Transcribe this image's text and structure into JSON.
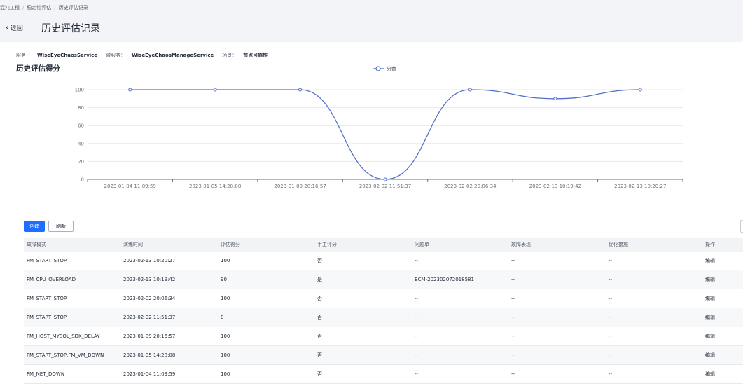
{
  "breadcrumb": [
    "混沌工程",
    "稳定性评估",
    "历史评估记录"
  ],
  "header": {
    "back_label": "返回",
    "title": "历史评估记录"
  },
  "meta": {
    "service_label": "服务：",
    "service_value": "WiseEyeChaosService",
    "micro_label": "微服务：",
    "micro_value": "WiseEyeChaosManageService",
    "scene_label": "场景：",
    "scene_value": "节点可靠性"
  },
  "chart_title": "历史评估得分",
  "chart_data": {
    "type": "line",
    "categories": [
      "2023-01-04 11:09:59",
      "2023-01-05 14:28:08",
      "2023-01-09 20:16:57",
      "2023-02-02 11:51:37",
      "2023-02-02 20:06:34",
      "2023-02-13 10:19:42",
      "2023-02-13 10:20:27"
    ],
    "series": [
      {
        "name": "分数",
        "values": [
          100,
          100,
          100,
          0,
          100,
          90,
          100
        ]
      }
    ],
    "yticks": [
      0,
      20,
      40,
      60,
      80,
      100
    ],
    "ylim": [
      0,
      100
    ],
    "grid": true,
    "legend": "top-center",
    "smooth": true,
    "colors": {
      "line": "#5470c6",
      "grid": "#e8e9ec",
      "axis": "#6e7079"
    }
  },
  "buttons": {
    "create": "创建",
    "refresh": "刷新"
  },
  "table": {
    "headers": [
      "故障模式",
      "演练时间",
      "评估得分",
      "手工评分",
      "问题单",
      "故障表现",
      "优化措施",
      "操作"
    ],
    "rows": [
      [
        "FM_START_STOP",
        "2023-02-13 10:20:27",
        "100",
        "否",
        "--",
        "--",
        "--",
        "编辑"
      ],
      [
        "FM_CPU_OVERLOAD",
        "2023-02-13 10:19:42",
        "90",
        "是",
        "BCM-202302072018581",
        "--",
        "--",
        "编辑"
      ],
      [
        "FM_START_STOP",
        "2023-02-02 20:06:34",
        "100",
        "否",
        "--",
        "--",
        "--",
        "编辑"
      ],
      [
        "FM_START_STOP",
        "2023-02-02 11:51:37",
        "0",
        "否",
        "--",
        "--",
        "--",
        "编辑"
      ],
      [
        "FM_HOST_MYSQL_SDK_DELAY",
        "2023-01-09 20:16:57",
        "100",
        "否",
        "--",
        "--",
        "--",
        "编辑"
      ],
      [
        "FM_START_STOP,FM_VM_DOWN",
        "2023-01-05 14:28:08",
        "100",
        "否",
        "--",
        "--",
        "--",
        "编辑"
      ],
      [
        "FM_NET_DOWN",
        "2023-01-04 11:09:59",
        "100",
        "否",
        "--",
        "--",
        "--",
        "编辑"
      ]
    ]
  },
  "colors": {
    "primary": "#1e6fff",
    "header_bg": "#f3f4f7"
  }
}
